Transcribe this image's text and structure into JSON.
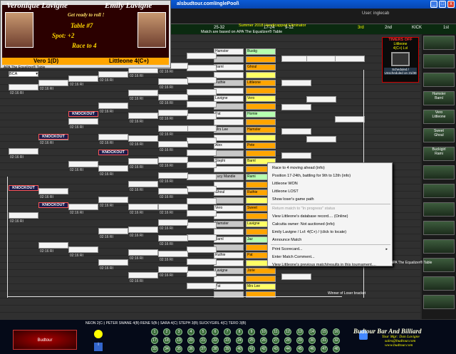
{
  "window": {
    "title": "alsbudtour.com\\InglePool\\",
    "user": "User: inglecab"
  },
  "columns": [
    {
      "label": "25-32",
      "hl": false
    },
    {
      "label": "17-24",
      "hl": false
    },
    {
      "label": "9-12",
      "hl": false
    },
    {
      "label": "3rd",
      "hl": true
    },
    {
      "label": "2nd",
      "hl": false
    },
    {
      "label": "KICK",
      "hl": false
    },
    {
      "label": "1st",
      "hl": false
    }
  ],
  "header": {
    "match_info": "Match are based on APA The Equalizer® Table",
    "event": "Summer 2018 Handicapped Eliminator"
  },
  "player_card": {
    "left_name": "Veronique Lavigne",
    "right_name": "Emily Lavigne",
    "ready": "Get ready to roll !",
    "table": "Table #7",
    "spot": "Spot: +2",
    "race": "Race to 4",
    "left_score": "Vero  1(D)",
    "right_score": "Littleone  4(C+)",
    "footer": "APA The Equalizer® Table",
    "division": "BCA"
  },
  "knockout_label": "KNOCKOUT",
  "timers": {
    "title": "TIMERS OFF",
    "sub1": "Littleone",
    "sub2": "4(C+) Lvl",
    "scheduled": "Scheduled / Unscheduled on 21/30"
  },
  "bracket_names": [
    "Bustig",
    "Ghoul",
    "Littleone",
    "Vero",
    "Homie",
    "Hamster",
    "Pete",
    "Barnl",
    "Rami",
    "Ruthie",
    "Sweet",
    "Lavigne",
    "Jaz",
    "Pat",
    "Jorie",
    "Mrs Lee",
    "Sara",
    "Alex",
    "Pooh",
    "Stephi",
    "Buckigirl",
    "Lucy Mandie"
  ],
  "menu": {
    "items": [
      {
        "label": "Race to 4 moving ahead (info)",
        "disabled": false
      },
      {
        "label": "Position 17-24th, battling for 9th to 12th (info)",
        "disabled": false
      },
      {
        "label": "Littleone WON",
        "disabled": false
      },
      {
        "label": "Littleone LOST",
        "disabled": false
      },
      {
        "label": "Show loser's game path",
        "disabled": false
      },
      {
        "label": "Return match to \"In progress\" status",
        "disabled": true
      },
      {
        "label": "View Littleone's database record.... (Online)",
        "disabled": false
      },
      {
        "label": "Calcutta owner: Not auctioned (info)",
        "disabled": false
      },
      {
        "label": "Emily Lavigne / Lvl: 4(C+) / (click to locate)",
        "disabled": false
      },
      {
        "label": "Announce Match",
        "disabled": false
      },
      {
        "label": "Print Scorecard...",
        "disabled": false
      },
      {
        "label": "Enter Match Comment...",
        "disabled": false
      },
      {
        "label": "View Littleone's previous match/results in this tournament....",
        "disabled": false
      }
    ]
  },
  "right_panel": [
    {
      "name": "Hamster",
      "sub": "Barnl"
    },
    {
      "name": "Vero",
      "sub": "Littleone"
    },
    {
      "name": "Sweet",
      "sub": "Ghoul"
    },
    {
      "name": "Buckigirl",
      "sub": "Rami"
    },
    {
      "name": "",
      "sub": ""
    },
    {
      "name": "",
      "sub": ""
    }
  ],
  "winner_label": "Winner of Loser bracket",
  "apa_label": "APA The Equalizer® Table",
  "bottom": {
    "players_line": "NEON  2(C-)  PETER  SWANE  4(B)  RENE  5(B-)  SARA  4(C)  STEPH  3(B)  SUCKYGIRL  4(C)  TERO  3(B)",
    "brand": "Budtour Bar And Billiard",
    "tour": "Tour Mgr: Dan Lavigne",
    "email": "sales@budtour.com",
    "site": "www.budtour.com",
    "balls_row1": [
      "1",
      "2",
      "3",
      "4",
      "5",
      "6",
      "7",
      "8",
      "9",
      "10",
      "11",
      "12",
      "13",
      "14",
      "15",
      "16"
    ],
    "balls_row2": [
      "17",
      "18",
      "19",
      "20",
      "21",
      "22",
      "23",
      "24",
      "25",
      "26",
      "27",
      "28",
      "29",
      "30",
      "31",
      "32"
    ],
    "balls_row3": [
      "33",
      "34",
      "35",
      "36",
      "37",
      "38",
      "39",
      "40",
      "41",
      "42",
      "43",
      "44",
      "45",
      "46",
      "47",
      "48"
    ]
  }
}
